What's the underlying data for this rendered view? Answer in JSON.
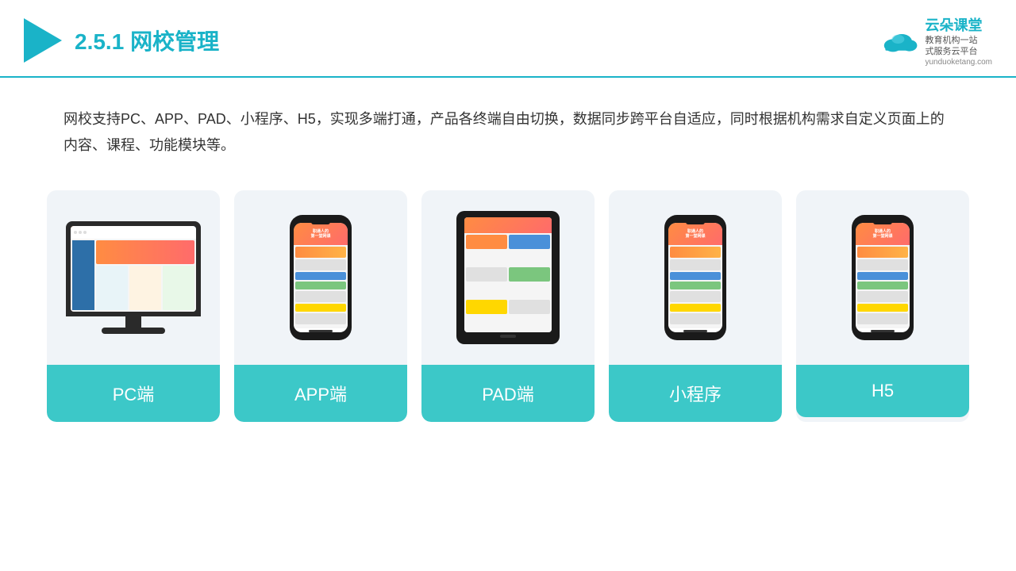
{
  "header": {
    "section_number": "2.5.1",
    "title_plain": "网校管理",
    "brand_name": "云朵课堂",
    "brand_url": "yunduoketang.com",
    "brand_tagline1": "教育机构一站",
    "brand_tagline2": "式服务云平台"
  },
  "description": {
    "text": "网校支持PC、APP、PAD、小程序、H5，实现多端打通，产品各终端自由切换，数据同步跨平台自适应，同时根据机构需求自定义页面上的内容、课程、功能模块等。"
  },
  "cards": [
    {
      "id": "pc",
      "label": "PC端",
      "device": "pc"
    },
    {
      "id": "app",
      "label": "APP端",
      "device": "phone"
    },
    {
      "id": "pad",
      "label": "PAD端",
      "device": "tablet"
    },
    {
      "id": "miniprogram",
      "label": "小程序",
      "device": "phone2"
    },
    {
      "id": "h5",
      "label": "H5",
      "device": "phone3"
    }
  ],
  "colors": {
    "accent": "#1ab3c8",
    "card_bg": "#f0f4f8",
    "label_bg": "#3cc8c8",
    "label_text": "#ffffff"
  }
}
